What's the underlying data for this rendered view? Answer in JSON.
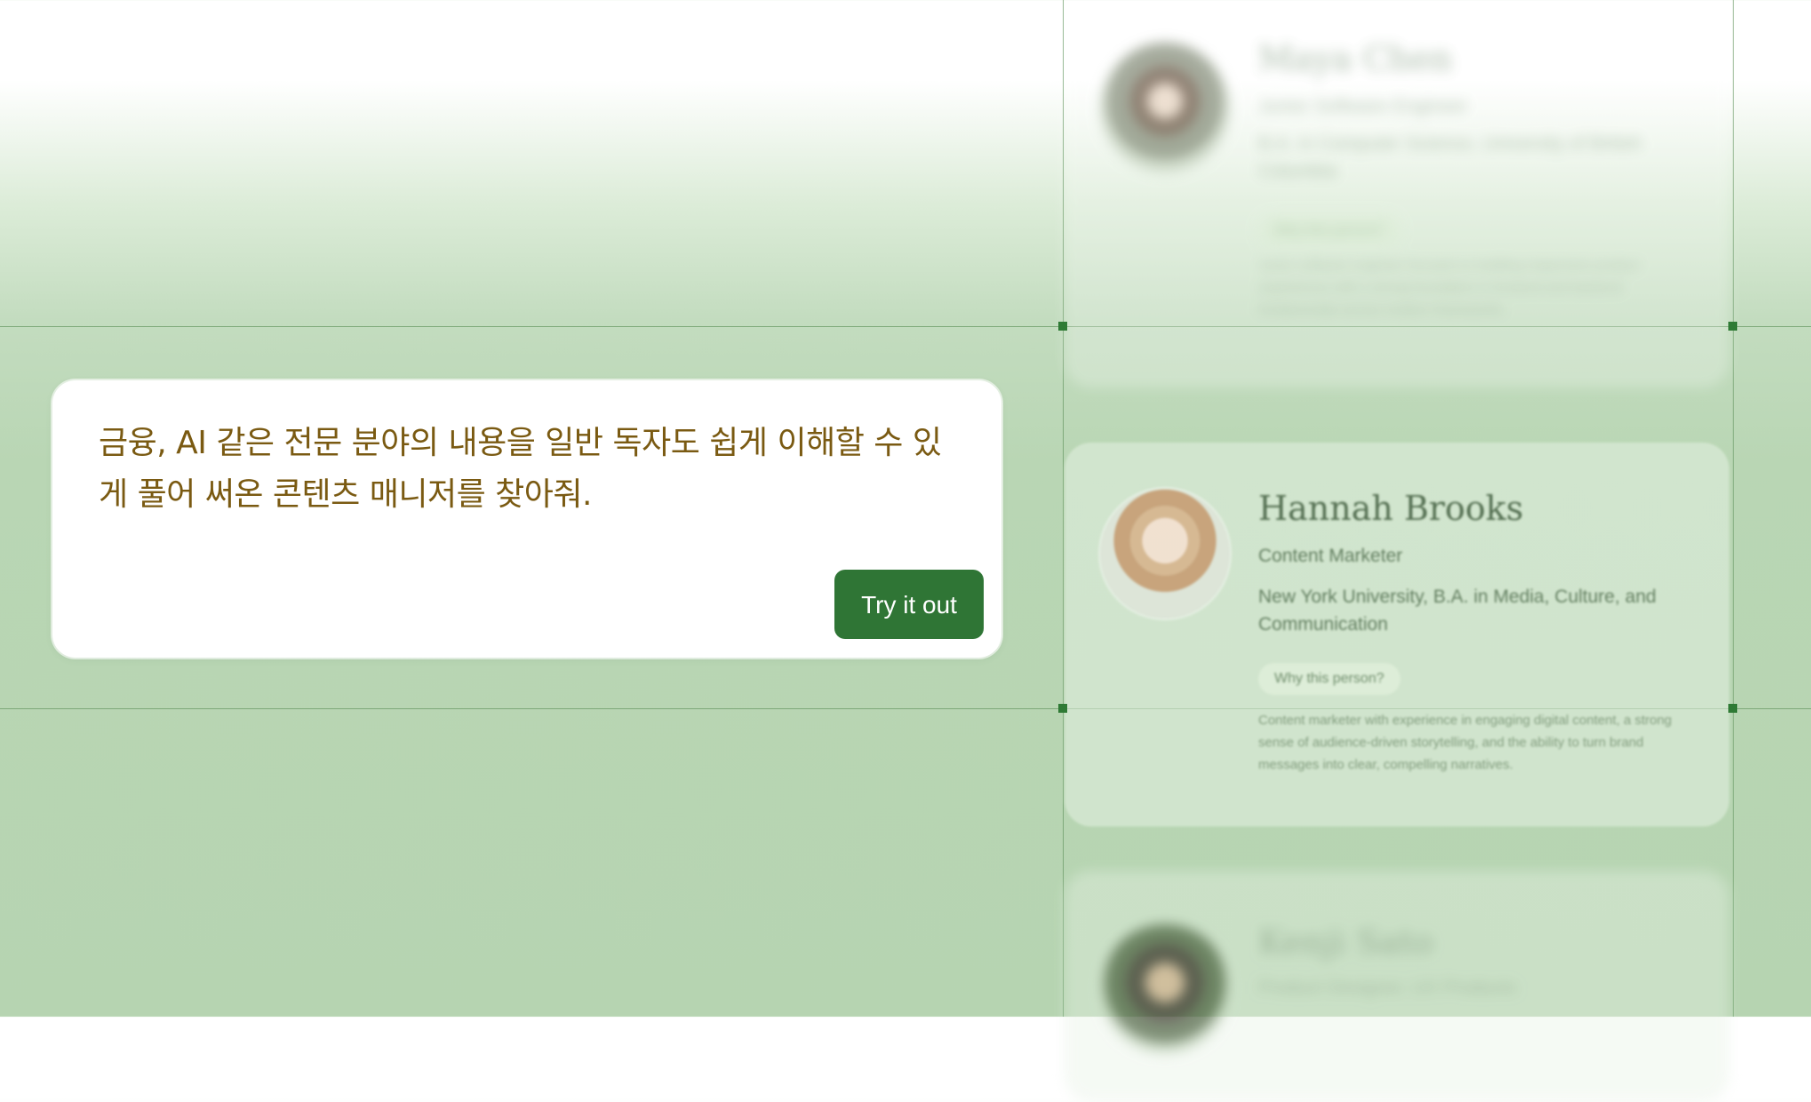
{
  "prompt": {
    "text": "금융, AI 같은 전문 분야의 내용을 일반 독자도 쉽게 이해할 수 있게 풀어 써온 콘텐츠 매니저를 찾아줘.",
    "button_label": "Try it out"
  },
  "profiles": [
    {
      "name": "Maya Chen",
      "role": "Junior Software Engineer",
      "education": "B.A. in Computer Science, University of British Columbia",
      "why_label": "Why this person?",
      "description": "Junior software engineer focused on building responsive product experiences with a strong foundation in frontend and backend fundamentals across modern frameworks."
    },
    {
      "name": "Hannah Brooks",
      "role": "Content Marketer",
      "education": "New York University, B.A. in Media, Culture, and Communication",
      "why_label": "Why this person?",
      "description": "Content marketer with experience in engaging digital content, a strong sense of audience-driven storytelling, and the ability to turn brand messages into clear, compelling narratives."
    },
    {
      "name": "Kenji Sato",
      "role": "Product Designer, UX Products"
    }
  ],
  "colors": {
    "accent": "#2f7535",
    "prompt_text": "#7a5a12",
    "background": "#b6d4b1"
  }
}
